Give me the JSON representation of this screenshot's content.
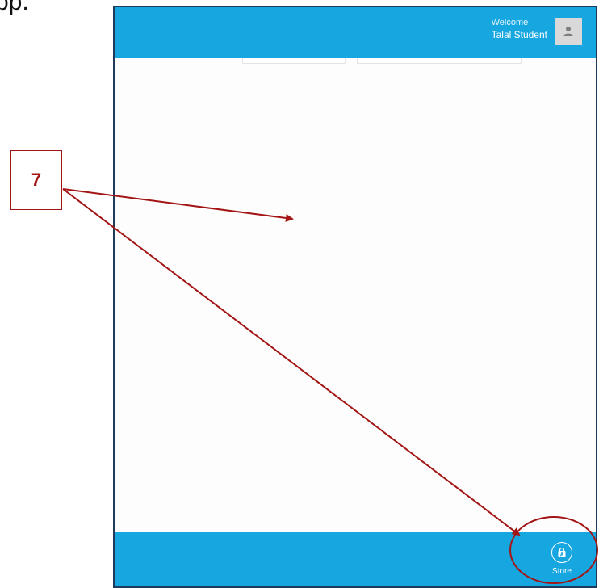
{
  "document": {
    "caption_fragment": "pp."
  },
  "header": {
    "welcome_label": "Welcome",
    "user_name": "Talal Student"
  },
  "footer": {
    "store_label": "Store"
  },
  "annotation": {
    "step_number": "7"
  },
  "colors": {
    "app_bar": "#16a6e0",
    "annotation": "#a31515",
    "border": "#1f3a5a"
  },
  "icons": {
    "avatar": "user-silhouette-icon",
    "store": "store-bag-icon"
  }
}
